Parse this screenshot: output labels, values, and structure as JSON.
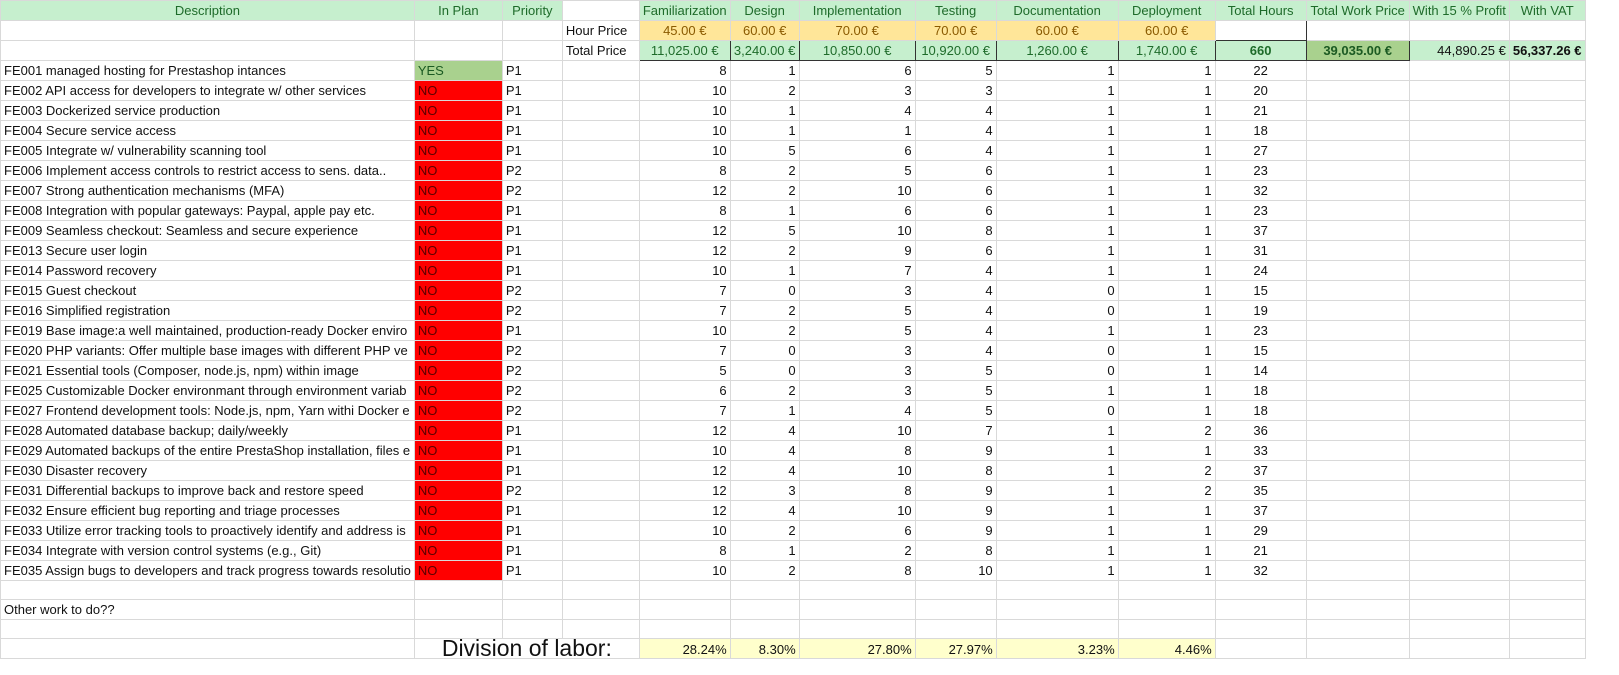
{
  "headers": {
    "description": "Description",
    "in_plan": "In Plan",
    "priority": "Priority",
    "familiarization": "Familiarization",
    "design": "Design",
    "implementation": "Implementation",
    "testing": "Testing",
    "documentation": "Documentation",
    "deployment": "Deployment",
    "total_hours": "Total Hours",
    "total_work_price": "Total Work Price",
    "with_profit": "With 15 % Profit",
    "with_vat": "With VAT"
  },
  "hour_price": {
    "label": "Hour Price",
    "values": [
      "45.00 €",
      "60.00 €",
      "70.00 €",
      "70.00 €",
      "60.00 €",
      "60.00 €"
    ]
  },
  "total_price": {
    "label": "Total Price",
    "values": [
      "11,025.00 €",
      "3,240.00 €",
      "10,850.00 €",
      "10,920.00 €",
      "1,260.00 €",
      "1,740.00 €"
    ],
    "total_hours": "660",
    "total_work_price": "39,035.00 €",
    "with_profit": "44,890.25 €",
    "with_vat": "56,337.26 €"
  },
  "features": [
    {
      "desc": "FE001 managed hosting for Prestashop intances",
      "plan": "YES",
      "prio": "P1",
      "h": [
        8,
        1,
        6,
        5,
        1,
        1
      ],
      "total": 22
    },
    {
      "desc": "FE002 API access for developers to integrate w/ other services",
      "plan": "NO",
      "prio": "P1",
      "h": [
        10,
        2,
        3,
        3,
        1,
        1
      ],
      "total": 20
    },
    {
      "desc": "FE003 Dockerized service production",
      "plan": "NO",
      "prio": "P1",
      "h": [
        10,
        1,
        4,
        4,
        1,
        1
      ],
      "total": 21
    },
    {
      "desc": "FE004 Secure service access",
      "plan": "NO",
      "prio": "P1",
      "h": [
        10,
        1,
        1,
        4,
        1,
        1
      ],
      "total": 18
    },
    {
      "desc": "FE005 Integrate w/ vulnerability scanning tool",
      "plan": "NO",
      "prio": "P1",
      "h": [
        10,
        5,
        6,
        4,
        1,
        1
      ],
      "total": 27
    },
    {
      "desc": "FE006 Implement access controls to restrict access to sens. data..",
      "plan": "NO",
      "prio": "P2",
      "h": [
        8,
        2,
        5,
        6,
        1,
        1
      ],
      "total": 23
    },
    {
      "desc": "FE007 Strong authentication mechanisms (MFA)",
      "plan": "NO",
      "prio": "P2",
      "h": [
        12,
        2,
        10,
        6,
        1,
        1
      ],
      "total": 32
    },
    {
      "desc": "FE008 Integration with popular gateways: Paypal, apple pay etc.",
      "plan": "NO",
      "prio": "P1",
      "h": [
        8,
        1,
        6,
        6,
        1,
        1
      ],
      "total": 23
    },
    {
      "desc": "FE009 Seamless checkout: Seamless and secure experience",
      "plan": "NO",
      "prio": "P1",
      "h": [
        12,
        5,
        10,
        8,
        1,
        1
      ],
      "total": 37
    },
    {
      "desc": "FE013 Secure user login",
      "plan": "NO",
      "prio": "P1",
      "h": [
        12,
        2,
        9,
        6,
        1,
        1
      ],
      "total": 31
    },
    {
      "desc": "FE014 Password recovery",
      "plan": "NO",
      "prio": "P1",
      "h": [
        10,
        1,
        7,
        4,
        1,
        1
      ],
      "total": 24
    },
    {
      "desc": "FE015 Guest checkout",
      "plan": "NO",
      "prio": "P2",
      "h": [
        7,
        0,
        3,
        4,
        0,
        1
      ],
      "total": 15
    },
    {
      "desc": "FE016 Simplified registration",
      "plan": "NO",
      "prio": "P2",
      "h": [
        7,
        2,
        5,
        4,
        0,
        1
      ],
      "total": 19
    },
    {
      "desc": "FE019 Base image:a well maintained, production-ready Docker enviro",
      "plan": "NO",
      "prio": "P1",
      "h": [
        10,
        2,
        5,
        4,
        1,
        1
      ],
      "total": 23
    },
    {
      "desc": "FE020 PHP variants: Offer multiple base images with different PHP ve",
      "plan": "NO",
      "prio": "P2",
      "h": [
        7,
        0,
        3,
        4,
        0,
        1
      ],
      "total": 15
    },
    {
      "desc": "FE021 Essential tools (Composer, node.js, npm) within image",
      "plan": "NO",
      "prio": "P2",
      "h": [
        5,
        0,
        3,
        5,
        0,
        1
      ],
      "total": 14
    },
    {
      "desc": "FE025 Customizable Docker environmant through environment variab",
      "plan": "NO",
      "prio": "P2",
      "h": [
        6,
        2,
        3,
        5,
        1,
        1
      ],
      "total": 18
    },
    {
      "desc": "FE027 Frontend development tools: Node.js, npm, Yarn withi Docker e",
      "plan": "NO",
      "prio": "P2",
      "h": [
        7,
        1,
        4,
        5,
        0,
        1
      ],
      "total": 18
    },
    {
      "desc": "FE028 Automated database backup; daily/weekly",
      "plan": "NO",
      "prio": "P1",
      "h": [
        12,
        4,
        10,
        7,
        1,
        2
      ],
      "total": 36
    },
    {
      "desc": "FE029 Automated backups of the entire PrestaShop installation, files e",
      "plan": "NO",
      "prio": "P1",
      "h": [
        10,
        4,
        8,
        9,
        1,
        1
      ],
      "total": 33
    },
    {
      "desc": "FE030 Disaster recovery",
      "plan": "NO",
      "prio": "P1",
      "h": [
        12,
        4,
        10,
        8,
        1,
        2
      ],
      "total": 37
    },
    {
      "desc": "FE031 Differential backups to improve back and restore speed",
      "plan": "NO",
      "prio": "P2",
      "h": [
        12,
        3,
        8,
        9,
        1,
        2
      ],
      "total": 35
    },
    {
      "desc": "FE032 Ensure efficient bug reporting and triage processes",
      "plan": "NO",
      "prio": "P1",
      "h": [
        12,
        4,
        10,
        9,
        1,
        1
      ],
      "total": 37
    },
    {
      "desc": "FE033 Utilize error tracking tools to proactively identify and address is",
      "plan": "NO",
      "prio": "P1",
      "h": [
        10,
        2,
        6,
        9,
        1,
        1
      ],
      "total": 29
    },
    {
      "desc": "FE034 Integrate with version control systems (e.g., Git)",
      "plan": "NO",
      "prio": "P1",
      "h": [
        8,
        1,
        2,
        8,
        1,
        1
      ],
      "total": 21
    },
    {
      "desc": "FE035 Assign bugs to developers and track progress towards resolutio",
      "plan": "NO",
      "prio": "P1",
      "h": [
        10,
        2,
        8,
        10,
        1,
        1
      ],
      "total": 32
    }
  ],
  "other_work": "Other work to do??",
  "division": {
    "label": "Division of labor:",
    "values": [
      "28.24%",
      "8.30%",
      "27.80%",
      "27.97%",
      "3.23%",
      "4.46%"
    ]
  },
  "colors": {
    "header_bg": "#c6efce",
    "header_text": "#1e6b2a",
    "rate_bg": "#ffe699",
    "yes_bg": "#a9d18e",
    "no_bg": "#ff0000",
    "pct_bg": "#ffffcc"
  }
}
